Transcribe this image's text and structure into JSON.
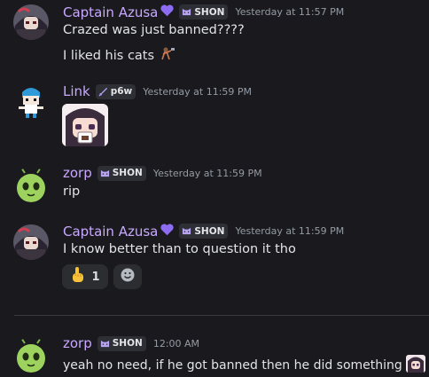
{
  "messages": [
    {
      "username": "Captain Azusa",
      "name_color": "#c8a8ff",
      "tag": "SHON",
      "timestamp": "Yesterday at 11:57 PM",
      "lines": [
        "Crazed was just banned????",
        "I liked his cats"
      ]
    },
    {
      "username": "Link",
      "name_color": "#c8a8ff",
      "tag": "p6w",
      "timestamp": "Yesterday at 11:59 PM",
      "sticker": "anime-girl-drinking-sticker"
    },
    {
      "username": "zorp",
      "name_color": "#c8a8ff",
      "tag": "SHON",
      "timestamp": "Yesterday at 11:59 PM",
      "lines": [
        "rip"
      ]
    },
    {
      "username": "Captain Azusa",
      "name_color": "#c8a8ff",
      "tag": "SHON",
      "timestamp": "Yesterday at 11:59 PM",
      "lines": [
        "I know better than to question it tho"
      ],
      "reactions": [
        {
          "emoji": "pointing-hand-icon",
          "count": "1"
        }
      ],
      "add_reaction_icon": "add-reaction-icon"
    },
    {
      "username": "zorp",
      "name_color": "#c8a8ff",
      "tag": "SHON",
      "timestamp": "12:00 AM",
      "lines": [
        "yeah no need, if he got banned then he did something"
      ]
    }
  ],
  "colors": {
    "background": "#1a1a1e",
    "tag_background": "#2e2f34",
    "timestamp": "#949ba4",
    "heart": "#8c6cf0"
  }
}
